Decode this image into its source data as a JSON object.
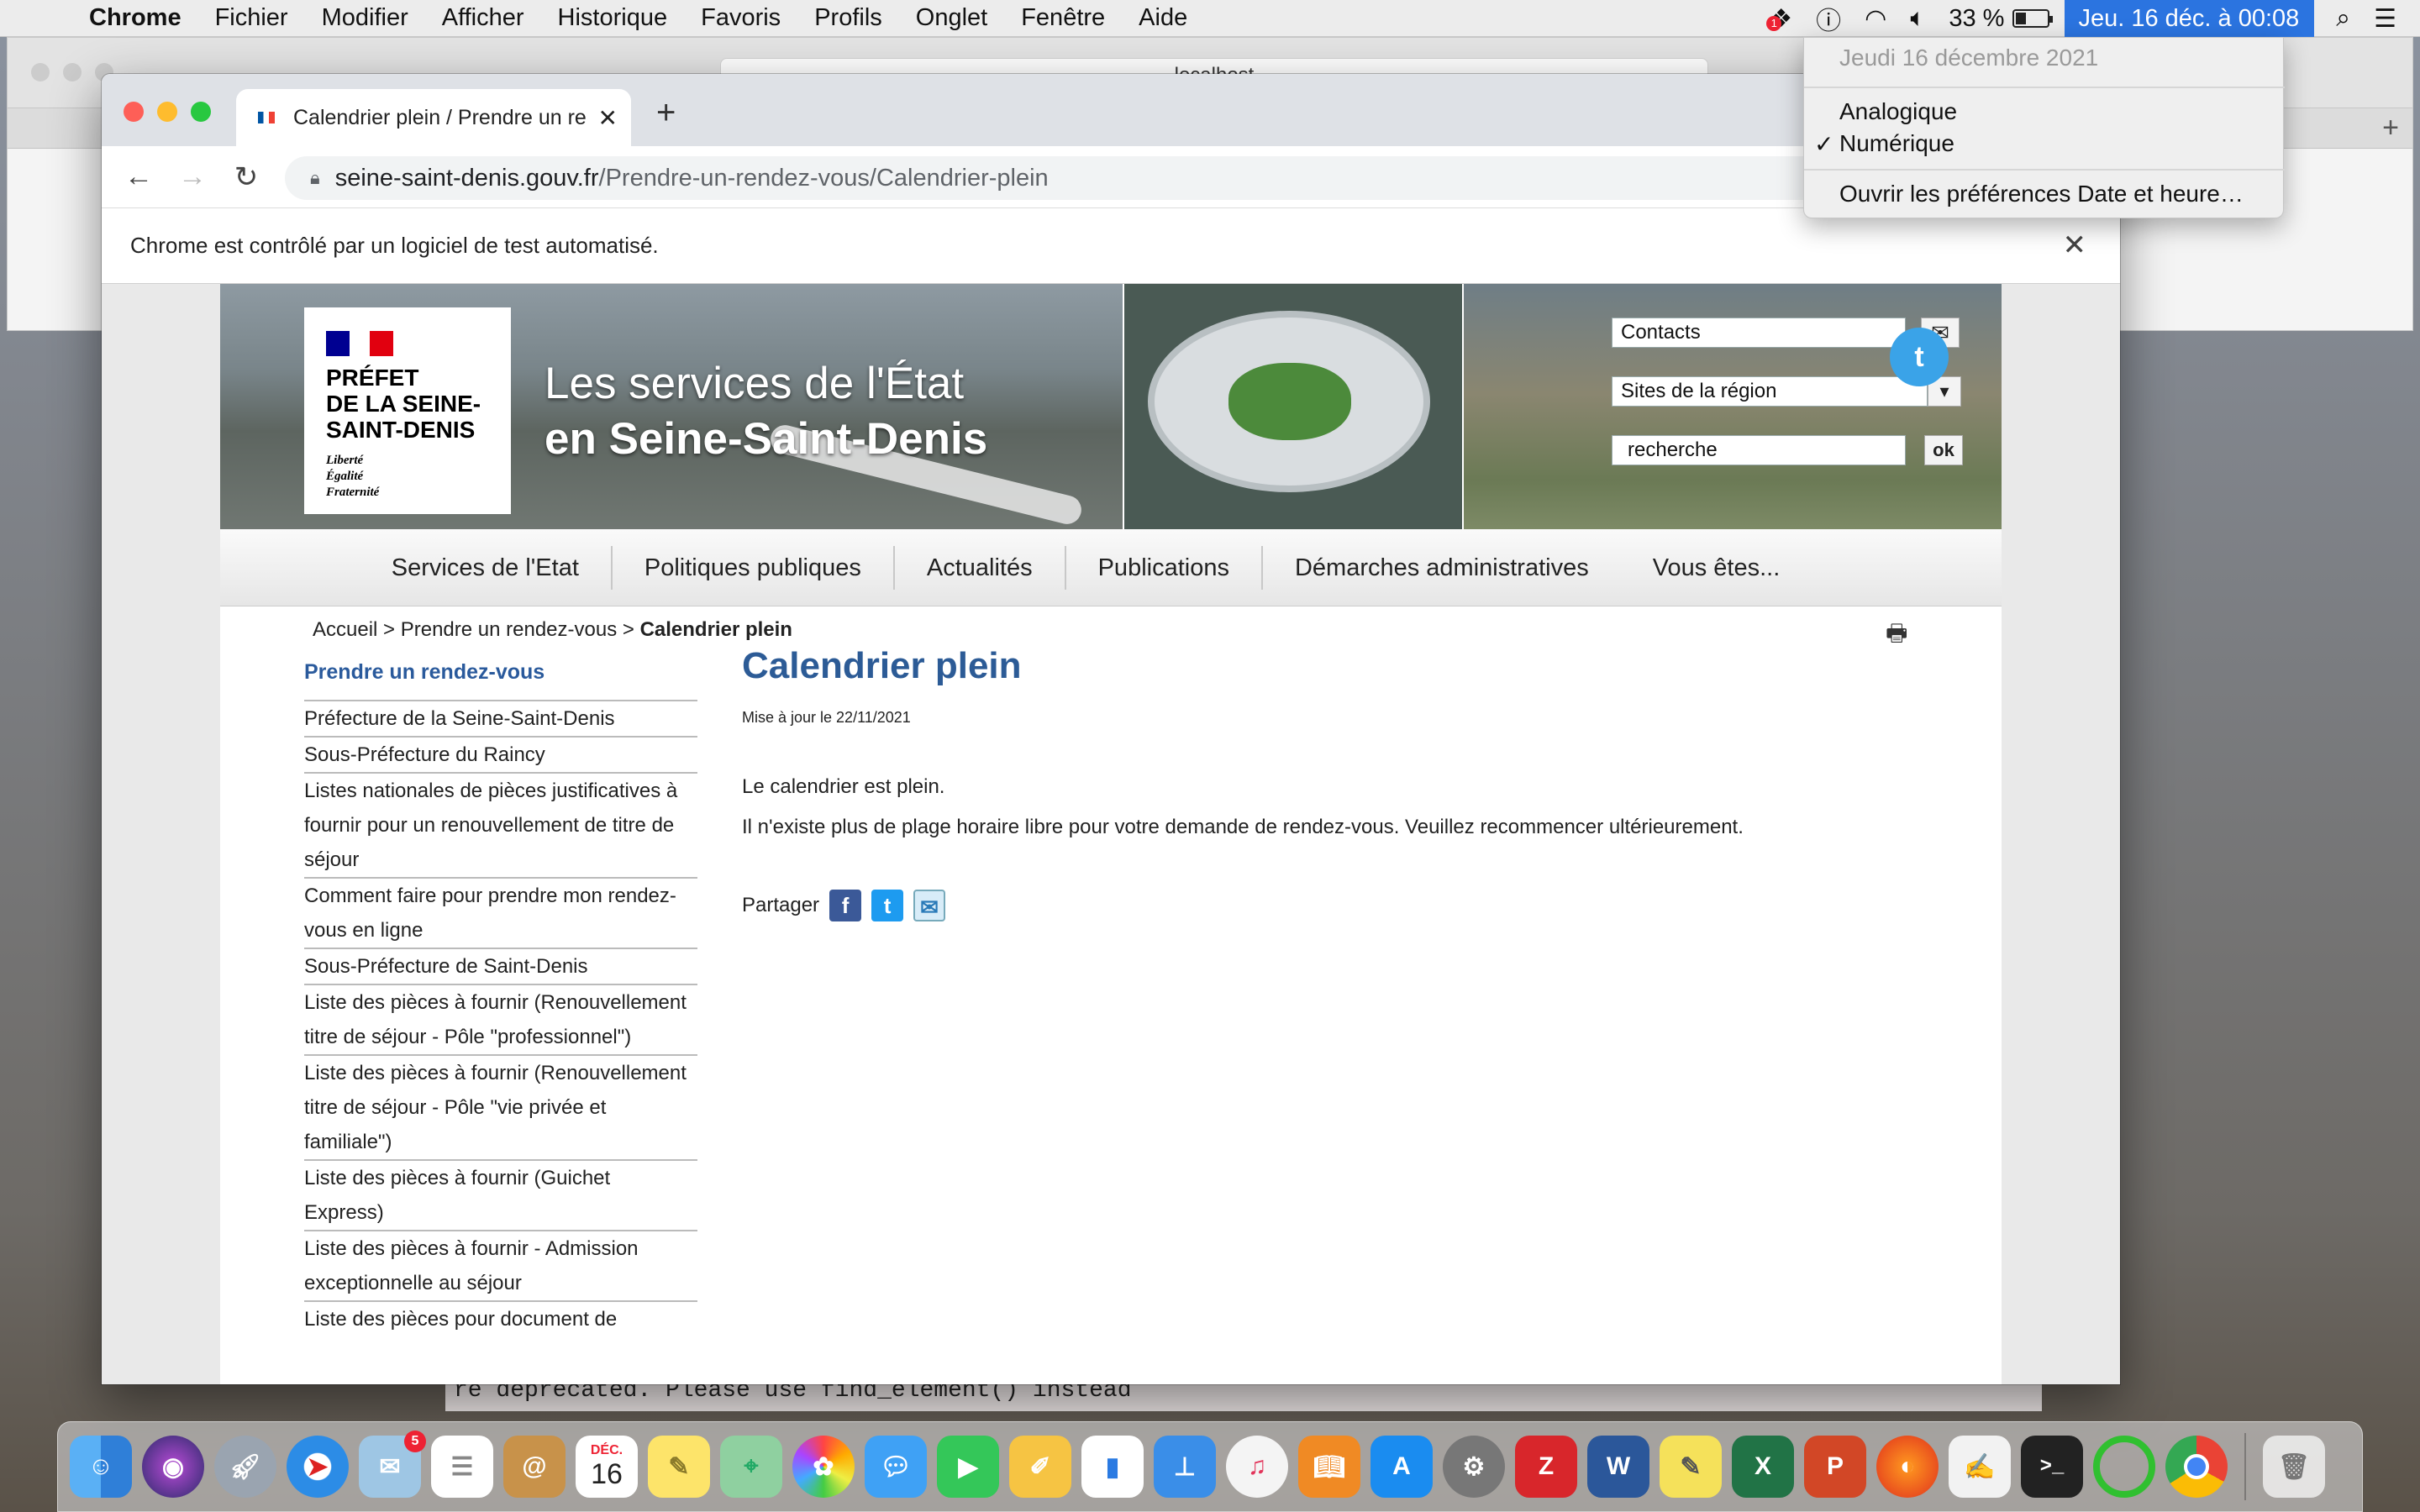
{
  "menubar": {
    "app_name": "Chrome",
    "menus": [
      "Fichier",
      "Modifier",
      "Afficher",
      "Historique",
      "Favoris",
      "Profils",
      "Onglet",
      "Fenêtre",
      "Aide"
    ],
    "notif_badge": "1",
    "battery": "33 %",
    "clock": "Jeu. 16 déc. à  00:08"
  },
  "clock_menu": {
    "date_header": "Jeudi 16 décembre 2021",
    "options": [
      "Analogique",
      "Numérique"
    ],
    "selected": "Numérique",
    "prefs": "Ouvrir les préférences Date et heure…"
  },
  "bg_window": {
    "address": "localhost",
    "terminal_text": "re deprecated. Please use find_element() instead"
  },
  "browser": {
    "tab_title": "Calendrier plein / Prendre un re",
    "url_domain": "seine-saint-denis.gouv.fr",
    "url_path": "/Prendre-un-rendez-vous/Calendrier-plein",
    "infobar": "Chrome est contrôlé par un logiciel de test automatisé."
  },
  "site": {
    "logo_lines": [
      "PRÉFET",
      "DE LA SEINE-",
      "SAINT-DENIS"
    ],
    "logo_motto": [
      "Liberté",
      "Égalité",
      "Fraternité"
    ],
    "banner_title_1": "Les services de l'État",
    "banner_title_2": "en Seine-Saint-Denis",
    "contacts": "Contacts",
    "sites_region": "Sites de la région",
    "search_placeholder": "recherche",
    "ok": "ok",
    "nav": [
      "Services de l'Etat",
      "Politiques publiques",
      "Actualités",
      "Publications",
      "Démarches administratives",
      "Vous êtes..."
    ],
    "breadcrumb": {
      "home": "Accueil",
      "sep": ">",
      "parent": "Prendre un rendez-vous",
      "current": "Calendrier plein"
    },
    "sidebar_title": "Prendre un rendez-vous",
    "sidebar_items": [
      "Préfecture de la Seine-Saint-Denis",
      "Sous-Préfecture du Raincy",
      "Listes nationales de pièces justificatives à fournir pour un renouvellement de titre de séjour",
      "Comment faire pour prendre mon rendez-vous en ligne",
      "Sous-Préfecture de Saint-Denis",
      "Liste des pièces à fournir (Renouvellement titre de séjour - Pôle \"professionnel\")",
      "Liste des pièces à fournir (Renouvellement titre de séjour - Pôle \"vie privée et familiale\")",
      "Liste des pièces à fournir (Guichet Express)",
      "Liste des pièces à fournir - Admission exceptionnelle au séjour",
      "Liste des pièces pour document de"
    ],
    "page_title": "Calendrier plein",
    "updated": "Mise à jour le 22/11/2021",
    "para1": "Le calendrier est plein.",
    "para2": "Il n'existe plus de plage horaire libre pour votre demande de rendez-vous. Veuillez recommencer ultérieurement.",
    "share_label": "Partager"
  },
  "dock": {
    "calendar_month": "DÉC.",
    "calendar_day": "16",
    "contacts_badge": "5"
  },
  "colors": {
    "accent": "#2b74e0",
    "site_title": "#2c5b96",
    "sidebar_title": "#2a5a9c"
  }
}
